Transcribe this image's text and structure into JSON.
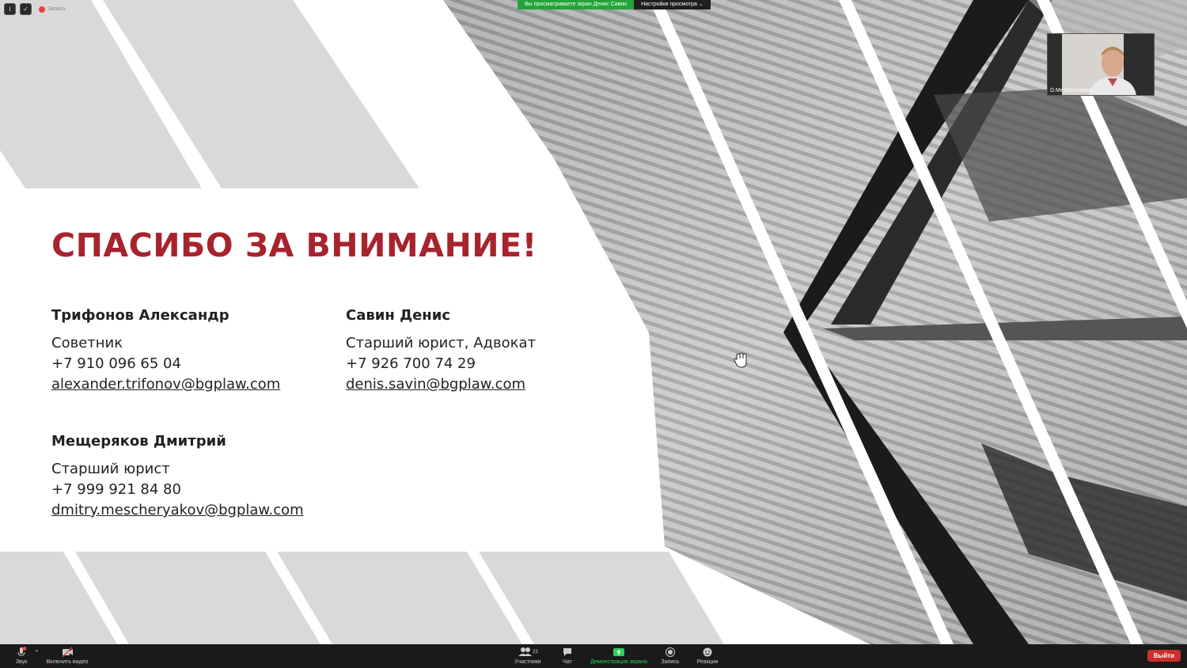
{
  "top_bar": {
    "recording_label": "Запись",
    "viewing_text": "Вы просматриваете экран Денис Савин",
    "view_options": "Настройки просмотра ⌄"
  },
  "slide": {
    "title": "СПАСИБО ЗА ВНИМАНИЕ!",
    "contacts": [
      {
        "name": "Трифонов Александр",
        "role": "Советник",
        "phone": "+7 910 096 65 04",
        "email": "alexander.trifonov@bgplaw.com"
      },
      {
        "name": "Савин Денис",
        "role": "Старший юрист, Адвокат",
        "phone": "+7 926 700 74 29",
        "email": "denis.savin@bgplaw.com"
      },
      {
        "name": "Мещеряков Дмитрий",
        "role": "Старший юрист",
        "phone": "+7 999 921 84 80",
        "email": "dmitry.mescheryakov@bgplaw.com"
      }
    ]
  },
  "participant_video": {
    "name": "D.Mescheryakov"
  },
  "toolbar": {
    "audio": "Звук",
    "video": "Включить видео",
    "participants": "Участники",
    "participants_count": "23",
    "chat": "Чат",
    "share": "Демонстрация экрана",
    "record": "Запись",
    "reactions": "Реакции",
    "leave": "Выйти"
  },
  "colors": {
    "title_red": "#a7232e",
    "share_green": "#2bd15a",
    "leave_red": "#c9302c"
  }
}
